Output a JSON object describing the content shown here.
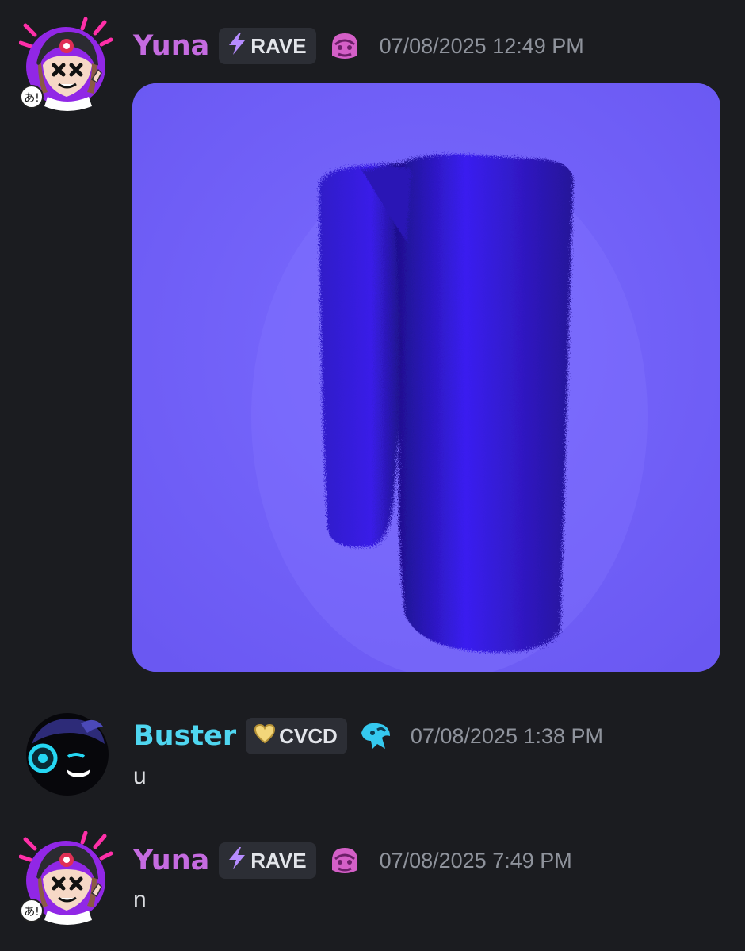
{
  "messages": [
    {
      "username": "Yuna",
      "username_color": "#c56be0",
      "tag": {
        "icon": "lightning-bolt-icon",
        "icon_glyph": "⚡",
        "label": "RAVE"
      },
      "role_icon": "pink-character-icon",
      "timestamp": "07/08/2025 12:49 PM",
      "attachment": {
        "type": "image",
        "subject": "fuzzy blue fur letter n",
        "background": "#6f5cf7",
        "fur_color": "#3a17e0"
      }
    },
    {
      "username": "Buster",
      "username_color": "#4fd6f0",
      "tag": {
        "icon": "yellow-heart-icon",
        "icon_glyph": "💛",
        "label": "CVCD"
      },
      "role_icon": "cyan-character-icon",
      "timestamp": "07/08/2025 1:38 PM",
      "text": "u"
    },
    {
      "username": "Yuna",
      "username_color": "#c56be0",
      "tag": {
        "icon": "lightning-bolt-icon",
        "icon_glyph": "⚡",
        "label": "RAVE"
      },
      "role_icon": "pink-character-icon",
      "timestamp": "07/08/2025 7:49 PM",
      "text": "n"
    }
  ]
}
